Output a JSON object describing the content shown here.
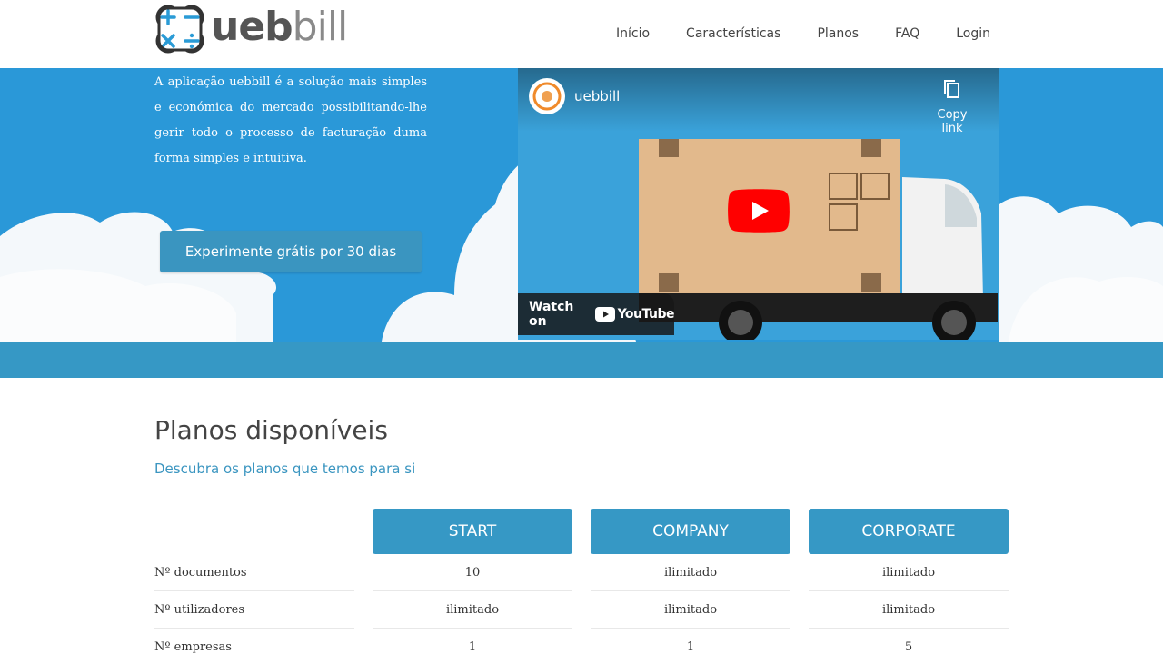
{
  "header": {
    "logo": {
      "part1": "ueb",
      "part2": "bill"
    },
    "nav": [
      {
        "label": "Início"
      },
      {
        "label": "Características"
      },
      {
        "label": "Planos"
      },
      {
        "label": "FAQ"
      },
      {
        "label": "Login"
      }
    ]
  },
  "hero": {
    "description": "A aplicação uebbill é a solução mais simples e económica do mercado possibilitando-lhe gerir todo o processo de facturação duma forma simples e intuitiva.",
    "cta_label": "Experimente grátis por 30 dias",
    "video": {
      "channel_name": "uebbill",
      "copy_link_label": "Copy link",
      "watch_on_label": "Watch on",
      "youtube_label": "YouTube"
    }
  },
  "plans": {
    "title": "Planos disponíveis",
    "subtitle": "Descubra os planos que temos para si",
    "columns": [
      "START",
      "COMPANY",
      "CORPORATE"
    ],
    "rows": [
      {
        "label": "Nº documentos",
        "values": [
          "10",
          "ilimitado",
          "ilimitado"
        ]
      },
      {
        "label": "Nº utilizadores",
        "values": [
          "ilimitado",
          "ilimitado",
          "ilimitado"
        ]
      },
      {
        "label": "Nº empresas",
        "values": [
          "1",
          "1",
          "5"
        ]
      }
    ]
  },
  "colors": {
    "accent": "#3698c5",
    "sky": "#2a98d8",
    "youtube_red": "#ff0000"
  }
}
